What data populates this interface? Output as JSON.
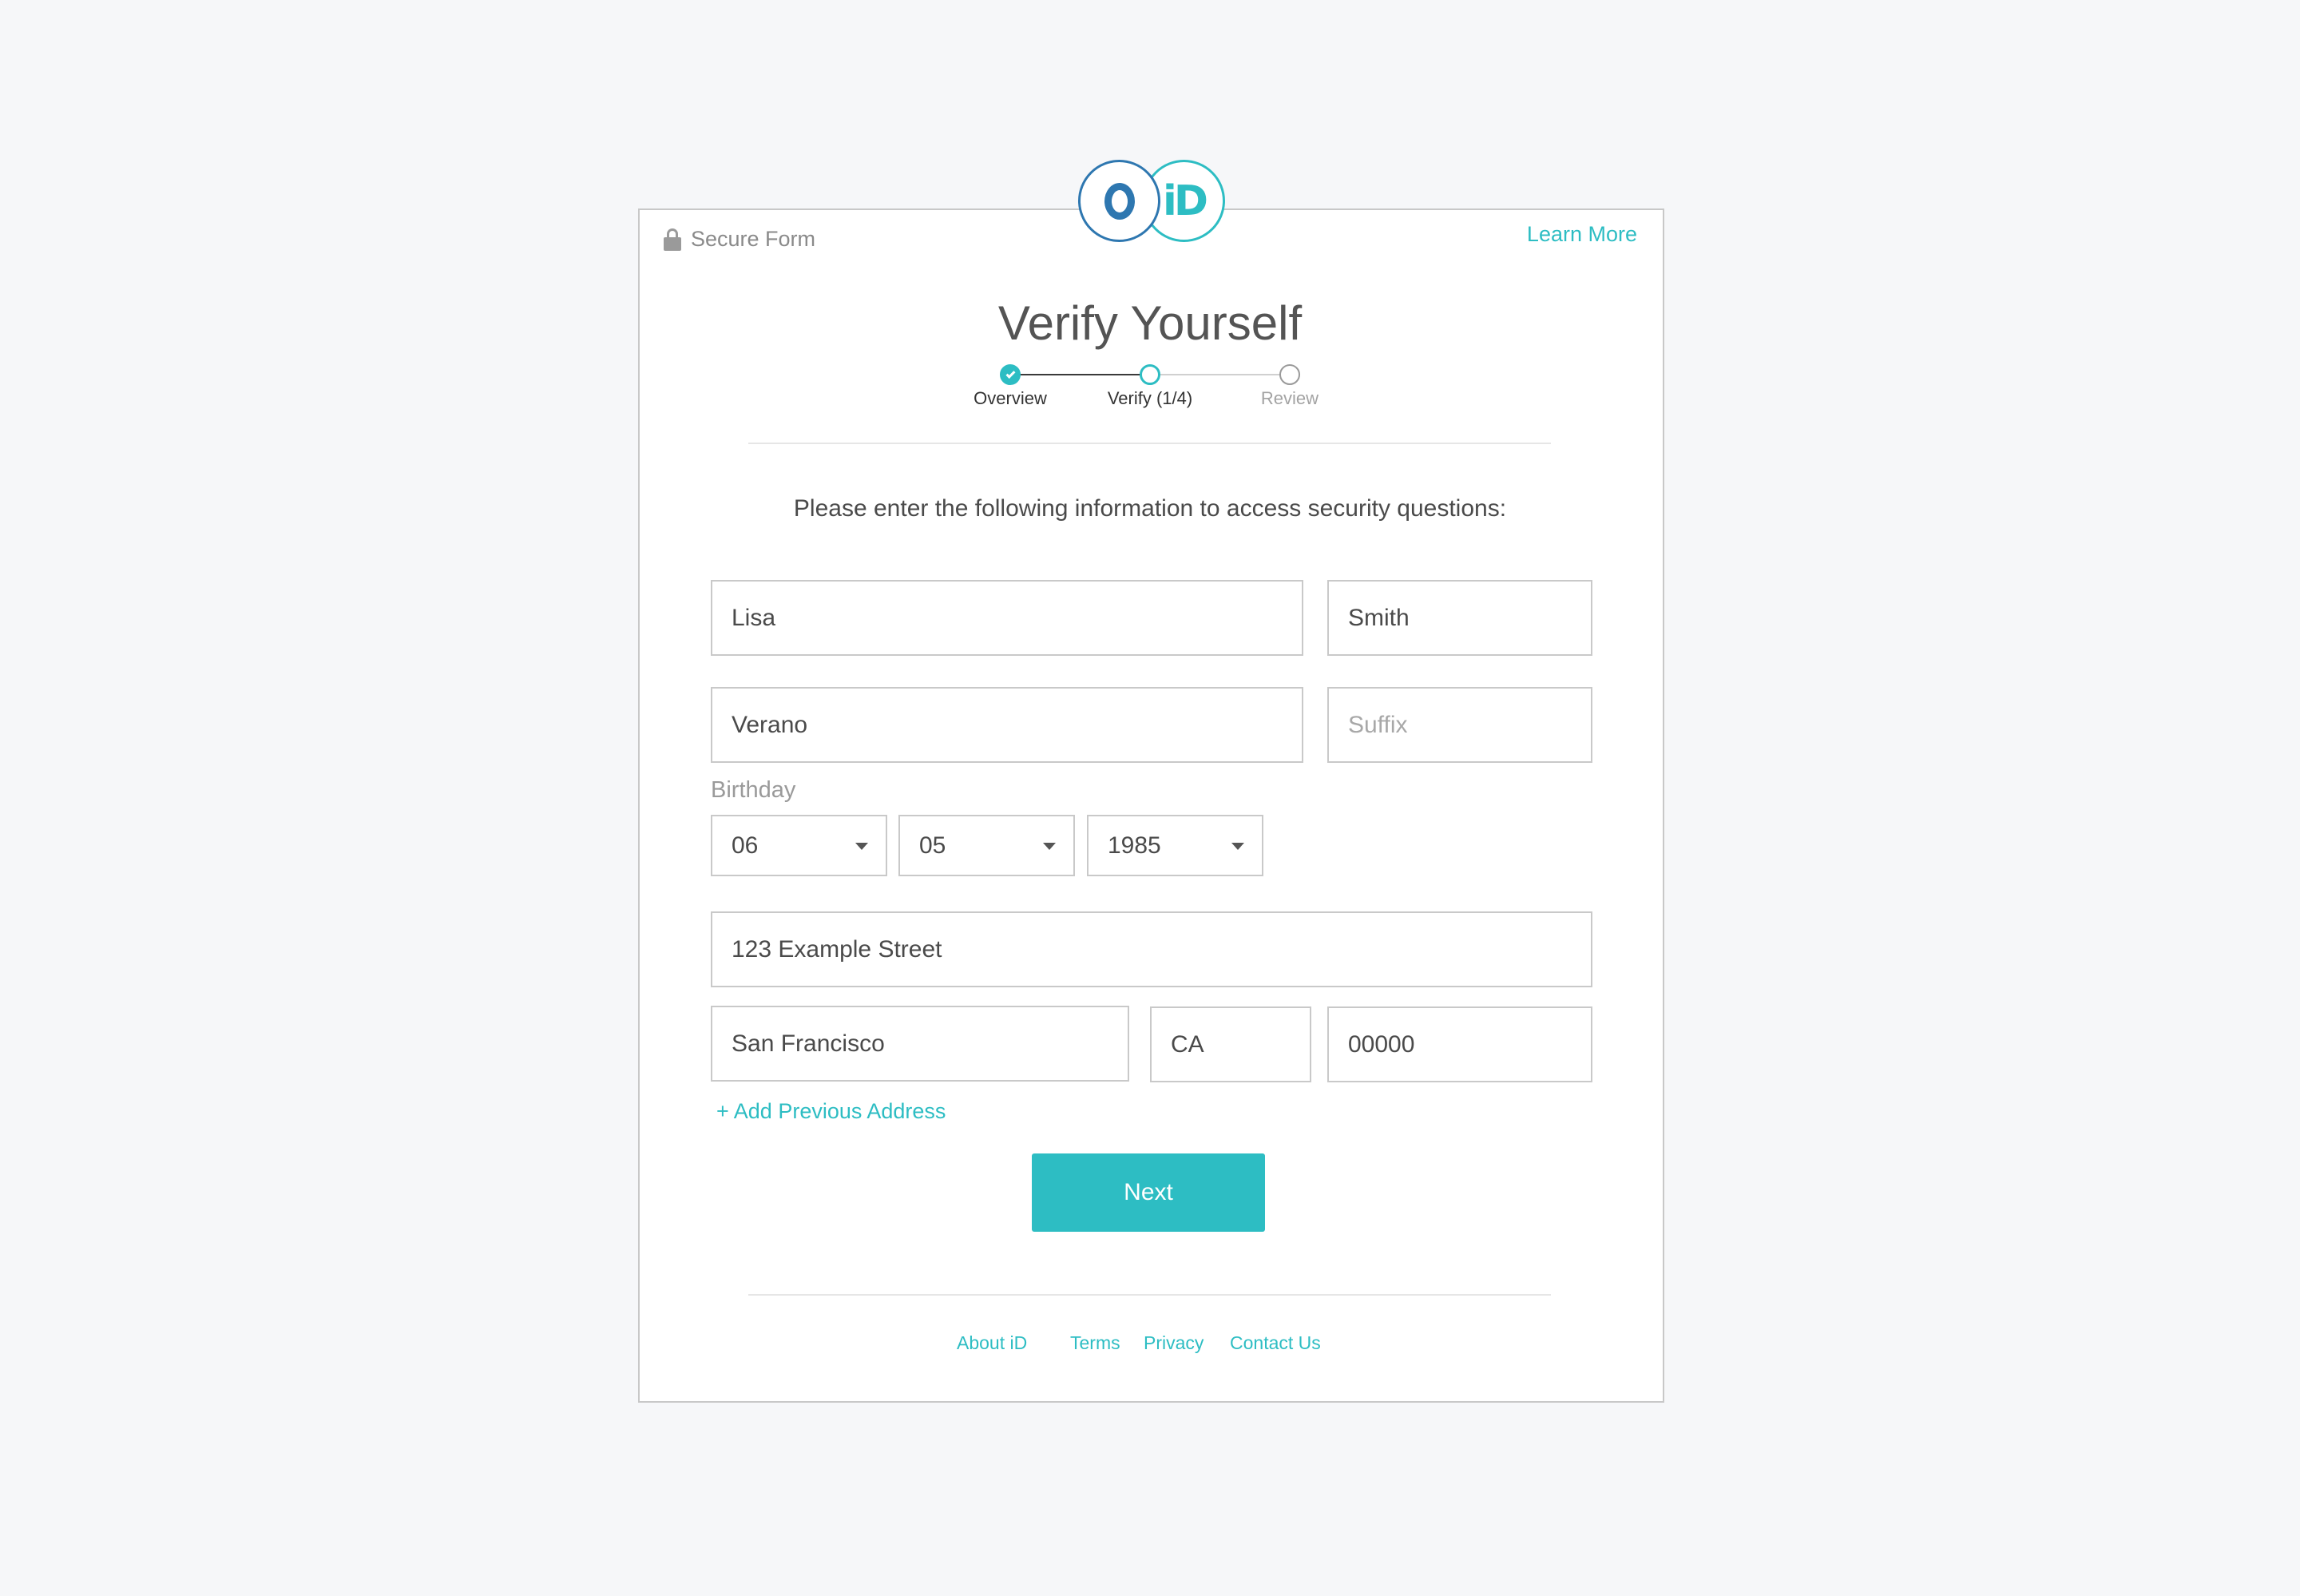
{
  "header": {
    "secure_label": "Secure Form",
    "learn_more": "Learn More",
    "logo_text": "iD"
  },
  "title": "Verify Yourself",
  "stepper": {
    "steps": [
      {
        "label": "Overview",
        "state": "complete"
      },
      {
        "label": "Verify (1/4)",
        "state": "current"
      },
      {
        "label": "Review",
        "state": "upcoming"
      }
    ]
  },
  "intro": "Please enter the following information to access security questions:",
  "form": {
    "first_name": "Lisa",
    "last_name": "Smith",
    "middle_name": "Verano",
    "suffix_placeholder": "Suffix",
    "birthday_label": "Birthday",
    "birth_month": "06",
    "birth_day": "05",
    "birth_year": "1985",
    "street": "123 Example Street",
    "city": "San Francisco",
    "state": "CA",
    "zip": "00000",
    "add_previous": "+ Add Previous Address",
    "next_label": "Next"
  },
  "footer": {
    "links": [
      "About iD",
      "Terms",
      "Privacy",
      "Contact Us"
    ]
  },
  "colors": {
    "accent": "#2dbdc3",
    "logo_blue": "#2e77b0",
    "text": "#4a4a4a",
    "border": "#c9c9c9",
    "background": "#f6f7f9"
  }
}
